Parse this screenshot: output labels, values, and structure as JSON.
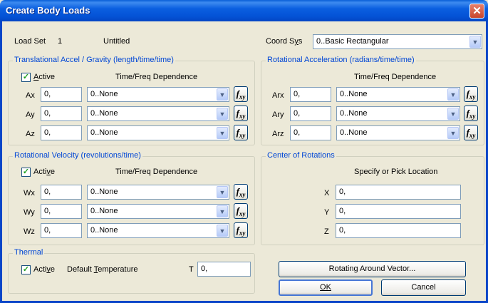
{
  "window": {
    "title": "Create Body Loads",
    "close_glyph": "✕"
  },
  "header": {
    "load_set_label": "Load Set",
    "load_set_id": "1",
    "load_set_name": "Untitled",
    "coord_sys_label": "Coord Sys",
    "coord_sys_value": "0..Basic Rectangular"
  },
  "translational": {
    "legend": "Translational Accel / Gravity  (length/time/time)",
    "active_label": "Active",
    "time_freq_header": "Time/Freq Dependence",
    "rows": [
      {
        "label": "Ax",
        "value": "0,",
        "dep": "0..None"
      },
      {
        "label": "Ay",
        "value": "0,",
        "dep": "0..None"
      },
      {
        "label": "Az",
        "value": "0,",
        "dep": "0..None"
      }
    ]
  },
  "rotational_accel": {
    "legend": "Rotational Acceleration (radians/time/time)",
    "time_freq_header": "Time/Freq Dependence",
    "rows": [
      {
        "label": "Arx",
        "value": "0,",
        "dep": "0..None"
      },
      {
        "label": "Ary",
        "value": "0,",
        "dep": "0..None"
      },
      {
        "label": "Arz",
        "value": "0,",
        "dep": "0..None"
      }
    ]
  },
  "rotational_velocity": {
    "legend": "Rotational Velocity (revolutions/time)",
    "active_label": "Active",
    "time_freq_header": "Time/Freq Dependence",
    "rows": [
      {
        "label": "Wx",
        "value": "0,",
        "dep": "0..None"
      },
      {
        "label": "Wy",
        "value": "0,",
        "dep": "0..None"
      },
      {
        "label": "Wz",
        "value": "0,",
        "dep": "0..None"
      }
    ]
  },
  "center_of_rotations": {
    "legend": "Center of Rotations",
    "header": "Specify or Pick Location",
    "rows": [
      {
        "label": "X",
        "value": "0,"
      },
      {
        "label": "Y",
        "value": "0,"
      },
      {
        "label": "Z",
        "value": "0,"
      }
    ]
  },
  "thermal": {
    "legend": "Thermal",
    "active_label": "Active",
    "default_temp_label": "Default Temperature",
    "t_label": "T",
    "t_value": "0,"
  },
  "buttons": {
    "rotating": "Rotating Around Vector...",
    "ok": "OK",
    "cancel": "Cancel"
  },
  "fxy": {
    "f": "f",
    "sub": "xy"
  },
  "check_glyph": "✓",
  "arrow_glyph": "▼"
}
